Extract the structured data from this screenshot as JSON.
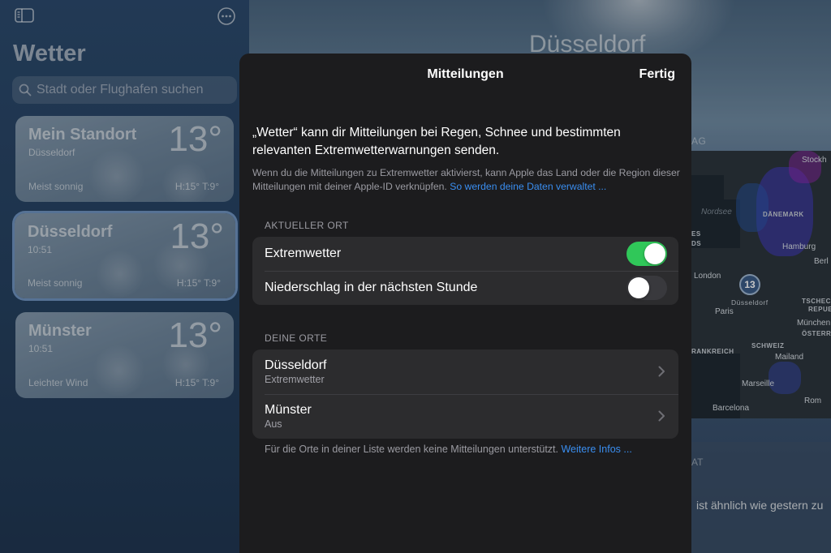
{
  "sidebar": {
    "title": "Wetter",
    "search_placeholder": "Stadt oder Flughafen suchen",
    "locations": [
      {
        "name": "Mein Standort",
        "sub": "Düsseldorf",
        "temp": "13°",
        "condition": "Meist sonnig",
        "hilo": "H:15°  T:9°"
      },
      {
        "name": "Düsseldorf",
        "sub": "10:51",
        "temp": "13°",
        "condition": "Meist sonnig",
        "hilo": "H:15°  T:9°"
      },
      {
        "name": "Münster",
        "sub": "10:51",
        "temp": "13°",
        "condition": "Leichter Wind",
        "hilo": "H:15°  T:9°"
      }
    ]
  },
  "background": {
    "city": "Düsseldorf",
    "map_section_label": "AG",
    "map_labels": {
      "stockholm": "Stockh",
      "nordsee": "Nordsee",
      "daenemark": "DÄNEMARK",
      "hamburg": "Hamburg",
      "berlin": "Berl",
      "london": "London",
      "paris": "Paris",
      "duesseldorf": "Düsseldorf",
      "tschechische": "TSCHECH",
      "republik": "REPUB",
      "muenchen": "München",
      "oesterreich": "ÖSTERREI",
      "schweiz": "SCHWEIZ",
      "frankreich": "RANKREICH",
      "mailand": "Mailand",
      "marseille": "Marseille",
      "rom": "Rom",
      "barcelona": "Barcelona",
      "es": "ES",
      "ds": "DS",
      "pin_temp": "13"
    },
    "bottom_label": "AT",
    "bottom_text": "ist ähnlich wie gestern zu"
  },
  "sheet": {
    "title": "Mitteilungen",
    "done_label": "Fertig",
    "intro": "„Wetter“ kann dir Mitteilungen bei Regen, Schnee und bestimmten relevanten Extremwetterwarnungen senden.",
    "privacy_text": "Wenn du die Mitteilungen zu Extremwetter aktivierst, kann Apple das Land oder die Region dieser Mitteilungen mit deiner Apple-ID verknüpfen.",
    "privacy_link": "So werden deine Daten verwaltet ...",
    "current_header": "AKTUELLER ORT",
    "current_rows": [
      {
        "label": "Extremwetter",
        "on": true
      },
      {
        "label": "Niederschlag in der nächsten Stunde",
        "on": false
      }
    ],
    "places_header": "DEINE ORTE",
    "places": [
      {
        "name": "Düsseldorf",
        "status": "Extremwetter"
      },
      {
        "name": "Münster",
        "status": "Aus"
      }
    ],
    "footer_text": "Für die Orte in deiner Liste werden keine Mitteilungen unterstützt.",
    "footer_link": "Weitere Infos ..."
  },
  "colors": {
    "accent": "#3a8ef0",
    "toggle_on": "#30c759",
    "sheet_bg": "#1c1c1e",
    "group_bg": "#2c2c2e"
  },
  "icons": [
    "sidebar-toggle-icon",
    "more-icon",
    "search-icon",
    "chevron-right-icon",
    "map-pin"
  ]
}
